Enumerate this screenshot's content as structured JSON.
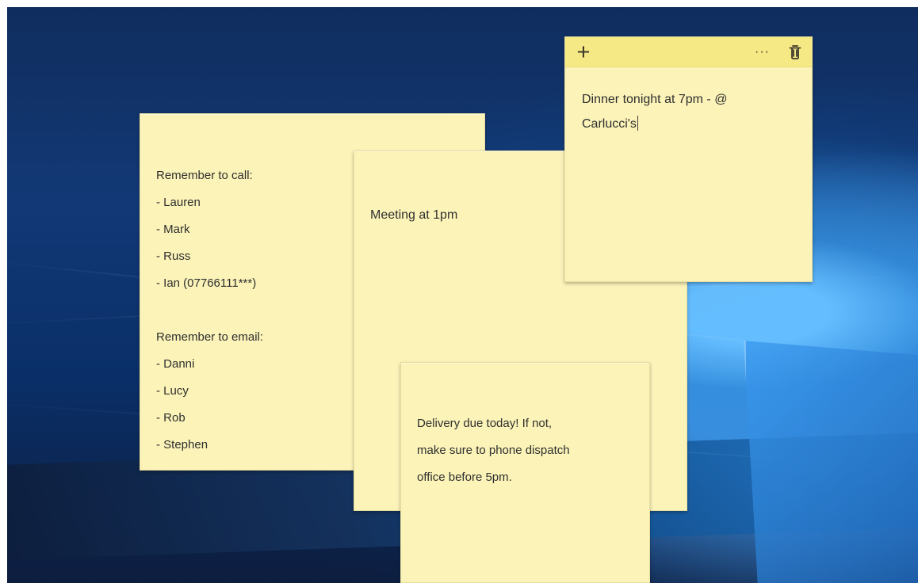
{
  "desktop": {
    "accent_blue": "#2e8ee6",
    "deep_blue": "#123976"
  },
  "notes": [
    {
      "id": "call-email",
      "color": "#fbf3b8",
      "content": "Remember to call:\n- Lauren\n- Mark\n- Russ\n- Ian (07766111***)\n\nRemember to email:\n- Danni\n- Lucy\n- Rob\n- Stephen"
    },
    {
      "id": "meeting",
      "color": "#fbf3b8",
      "content": "Meeting at 1pm"
    },
    {
      "id": "delivery",
      "color": "#fbf3b8",
      "content": "Delivery due today! If not,\nmake sure to phone dispatch\noffice before 5pm."
    },
    {
      "id": "dinner",
      "color": "#fbf3b8",
      "header_color": "#f5e985",
      "toolbar": {
        "add_icon": "plus-icon",
        "add_symbol": "+",
        "more_icon": "more-icon",
        "more_symbol": "···",
        "delete_icon": "trash-icon"
      },
      "content": "Dinner tonight at 7pm - @\nCarlucci's"
    }
  ]
}
